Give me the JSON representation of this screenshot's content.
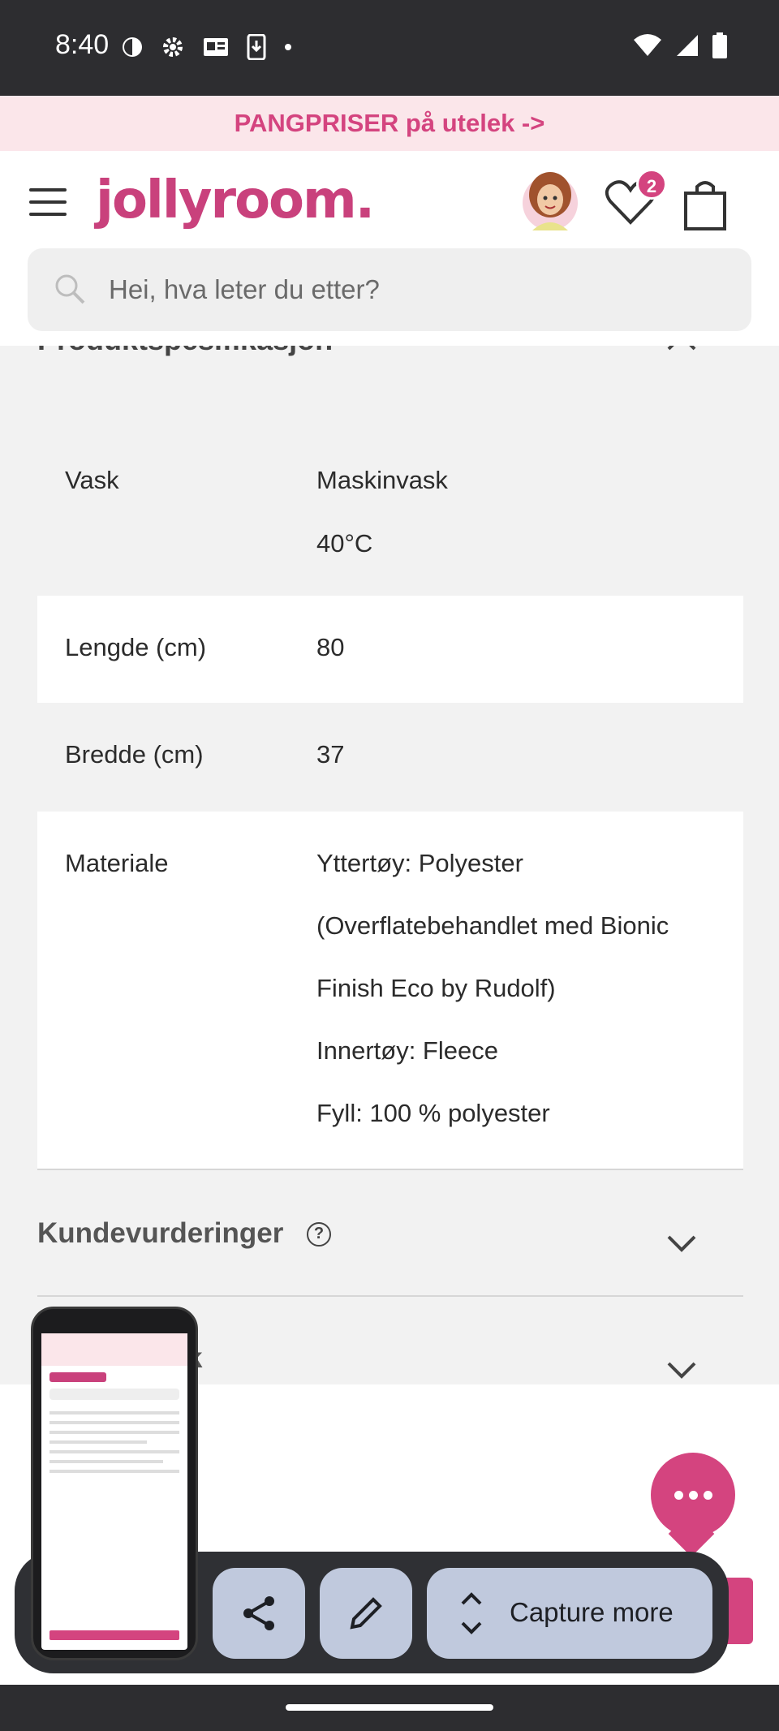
{
  "status_bar": {
    "time": "8:40"
  },
  "promo": {
    "text": "PANGPRISER på utelek ->"
  },
  "header": {
    "logo": "jollyroom.",
    "favorites_count": "2"
  },
  "search": {
    "placeholder": "Hei, hva leter du etter?"
  },
  "section": {
    "title": "Produktspesifikasjon"
  },
  "specs": [
    {
      "key": "Vask",
      "values": [
        "Maskinvask",
        "40°C"
      ]
    },
    {
      "key": "Lengde (cm)",
      "values": [
        "80"
      ]
    },
    {
      "key": "Bredde (cm)",
      "values": [
        "37"
      ]
    },
    {
      "key": "Materiale",
      "values": [
        "Yttertøy: Polyester",
        "(Overflatebehandlet med Bionic",
        "Finish Eco by Rudolf)",
        "Innertøy: Fleece",
        "Fyll: 100 % polyester"
      ]
    }
  ],
  "accordions": [
    {
      "title": "Kundevurderinger"
    },
    {
      "title": "k"
    }
  ],
  "toolbar": {
    "capture_label": "Capture more"
  }
}
